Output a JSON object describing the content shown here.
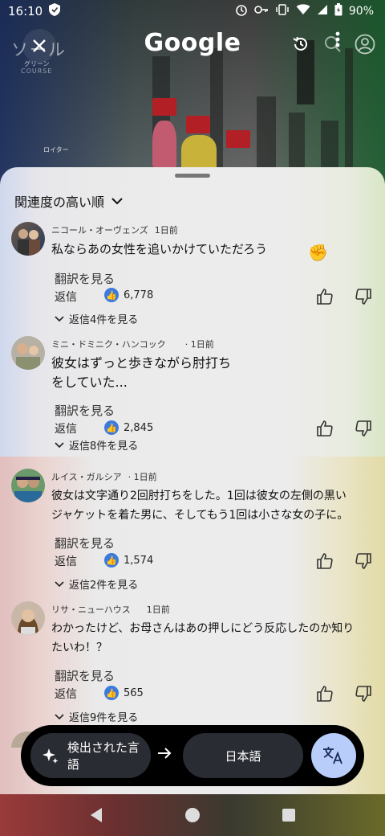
{
  "status": {
    "time": "16:10",
    "battery": "90%"
  },
  "header": {
    "logo": "Google",
    "faded_nav": "ソール",
    "faded_sub": "グリーン",
    "faded_sub2": "COURSE",
    "video_caption": "ロイター"
  },
  "sheet": {
    "sort_label": "関連度の高い順"
  },
  "comments": [
    {
      "author": "ニコール・オーヴェンズ",
      "time": "1日前",
      "text_lines": [
        "私ならあの女性を追いかけていただろう"
      ],
      "translate": "翻訳を見る",
      "reply": "返信",
      "likes": "6,778",
      "replies": "返信4件を見る"
    },
    {
      "author": "ミニ・ドミニク・ハンコック",
      "time": "· 1日前",
      "text_lines": [
        "彼女はずっと歩きながら肘打ち",
        "をしていた..."
      ],
      "translate": "翻訳を見る",
      "reply": "返信",
      "likes": "2,845",
      "replies": "返信8件を見る"
    },
    {
      "author": "ルイス・ガルシア",
      "time": "· 1日前",
      "text_lines": [
        "彼女は文字通り2回肘打ちをした。1回は彼女の左側の黒い",
        "ジャケットを着た男に、そしてもう1回は小さな女の子に。"
      ],
      "translate": "翻訳を見る",
      "reply": "返信",
      "likes": "1,574",
      "replies": "返信2件を見る"
    },
    {
      "author": "リサ・ニューハウス",
      "time": "1日前",
      "text_lines": [
        "わかったけど、お母さんはあの押しにどう反応したのか知り",
        "たいわ！？"
      ],
      "translate": "翻訳を見る",
      "reply": "返信",
      "likes": "565",
      "replies": "返信9件を見る"
    }
  ],
  "translation_bar": {
    "detected_label": "検出された言語",
    "target_label": "日本語",
    "fab_icon": "translate-icon"
  },
  "icons": {
    "close": "close-icon",
    "history": "history-icon",
    "more": "more-vert-icon",
    "account": "account-icon",
    "search": "search-icon"
  },
  "colors": {
    "like_blue": "#3b7be0",
    "fab_bg": "#b9cdfa"
  }
}
